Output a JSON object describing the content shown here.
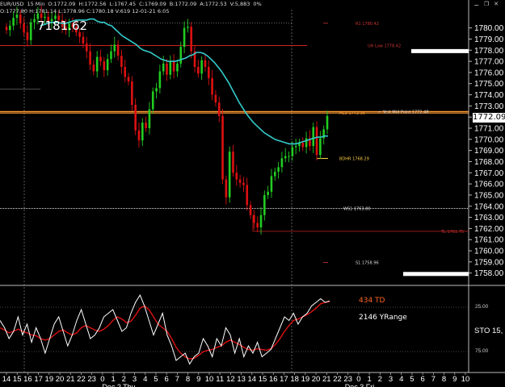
{
  "header": {
    "pair": "EUR/USD",
    "timeframe": "15 Min",
    "open": "O:1772.09",
    "high": "H:1772.56",
    "low": "L:1767.45",
    "close": "C:1769.09",
    "bid": "B:1772.09",
    "ask": "A:1772.53",
    "volume": "V:5,883",
    "extra": "0%"
  },
  "header2": {
    "open": "O:1777.80",
    "high": "H:1781.14",
    "low": "L:1778.96",
    "close": "C:1780.18",
    "vol": "V:619",
    "time": "12-01-21",
    "tick": "6:05"
  },
  "big_label": "7181.62",
  "current_price": "1772.09",
  "level_labels": {
    "r1": "R1 1780.42",
    "uh_low": "UH Low 1778.42",
    "hl3": "HL3 1772.36",
    "yest_mid": "Yest Mid Point 1772.48",
    "bdhr": "BDHR 1768.29",
    "ws1": "WS1 1763.80",
    "tl": "TL 1761.75",
    "s1": "S1 1758.96"
  },
  "indicator": {
    "td_label": "434 TD",
    "yrange_label": "2146 YRange",
    "sto_label": "STO 15,",
    "level_upper": "25.00",
    "level_lower": "75.00"
  },
  "icons": [
    "minimize-icon",
    "restore-icon",
    "close-icon"
  ],
  "colors": {
    "background": "#000000",
    "up_candle": "#22cc22",
    "down_candle": "#dd1111",
    "ma_line": "#33cccc",
    "level_red": "#cc2222",
    "level_orange": "#ff9933",
    "level_white": "#dddddd",
    "stoch_k": "#ffffff",
    "stoch_d": "#dd1111",
    "td_text": "#ff6622"
  },
  "chart_data": {
    "type": "line",
    "title": "",
    "series_kind": "candlestick",
    "y_range": [
      1757,
      1781.6
    ],
    "y_ticks": [
      1780,
      1779,
      1778,
      1777,
      1776,
      1775,
      1774,
      1773,
      1772,
      1771,
      1770,
      1769,
      1768,
      1767,
      1766,
      1765,
      1764,
      1763,
      1762,
      1761,
      1760,
      1759,
      1758
    ],
    "x_ticks": [
      "14",
      "15",
      "16",
      "17",
      "19",
      "20",
      "21",
      "22",
      "23",
      "0",
      "1",
      "2",
      "3",
      "4",
      "5",
      "6",
      "7",
      "8",
      "9",
      "10",
      "11",
      "12",
      "13",
      "14",
      "15",
      "16",
      "17",
      "18",
      "19",
      "20",
      "21",
      "22",
      "23",
      "0",
      "1",
      "2",
      "3",
      "4",
      "5",
      "6",
      "7",
      "8",
      "9",
      "10"
    ],
    "x_sublabels": [
      "Dec 2 Thu",
      "Dec 3 Fri"
    ],
    "closes": [
      1779.8,
      1780.2,
      1780.9,
      1781.2,
      1780.4,
      1779.6,
      1778.9,
      1780.5,
      1780.8,
      1781.3,
      1780.9,
      1781.0,
      1780.6,
      1780.8,
      1781.1,
      1780.7,
      1780.1,
      1779.8,
      1780.4,
      1780.1,
      1779.6,
      1779.2,
      1778.6,
      1777.9,
      1776.7,
      1776.1,
      1777.4,
      1777.0,
      1776.2,
      1777.2,
      1777.9,
      1778.5,
      1777.5,
      1776.5,
      1775.6,
      1775.2,
      1773.1,
      1770.8,
      1769.9,
      1771.5,
      1771.0,
      1772.7,
      1774.3,
      1774.6,
      1776.1,
      1776.8,
      1775.8,
      1777.0,
      1776.1,
      1776.8,
      1778.3,
      1780.0,
      1780.1,
      1777.9,
      1776.5,
      1775.9,
      1777.1,
      1776.5,
      1775.5,
      1774.0,
      1773.3,
      1772.1,
      1766.4,
      1764.8,
      1768.9,
      1767.0,
      1766.4,
      1766.1,
      1765.9,
      1764.1,
      1763.2,
      1762.5,
      1762.1,
      1763.2,
      1765.0,
      1765.3,
      1766.7,
      1767.1,
      1767.5,
      1768.3,
      1768.5,
      1768.5,
      1769.3,
      1769.4,
      1769.7,
      1769.3,
      1770.1,
      1769.4,
      1771.1,
      1768.6,
      1770.1,
      1770.9,
      1772.1
    ],
    "ma": [
      1780.2,
      1780.3,
      1780.4,
      1780.5,
      1780.5,
      1780.5,
      1780.4,
      1780.4,
      1780.5,
      1780.6,
      1780.7,
      1780.7,
      1780.7,
      1780.7,
      1780.8,
      1780.8,
      1780.6,
      1780.5,
      1780.5,
      1780.3,
      1780.2,
      1779.9,
      1779.6,
      1779.3,
      1779.1,
      1778.9,
      1778.7,
      1778.5,
      1778.2,
      1778.0,
      1777.9,
      1777.8,
      1777.6,
      1777.4,
      1777.2,
      1777.1,
      1777.0,
      1777.0,
      1777.0,
      1777.1,
      1777.2,
      1777.3,
      1777.5,
      1777.6,
      1777.8,
      1777.8,
      1777.7,
      1777.5,
      1777.2,
      1776.9,
      1776.5,
      1776.1,
      1775.6,
      1775.1,
      1774.5,
      1773.9,
      1773.3,
      1772.8,
      1772.3,
      1771.9,
      1771.5,
      1771.2,
      1770.9,
      1770.6,
      1770.4,
      1770.2,
      1770.0,
      1769.9,
      1769.8,
      1769.7,
      1769.6,
      1769.6,
      1769.6,
      1769.7,
      1769.8,
      1769.9,
      1770.0,
      1770.1,
      1770.2,
      1770.2,
      1770.3,
      1770.3
    ],
    "stoch_k": [
      35,
      45,
      60,
      50,
      30,
      55,
      40,
      65,
      45,
      60,
      80,
      60,
      40,
      30,
      50,
      70,
      55,
      35,
      20,
      40,
      60,
      55,
      45,
      30,
      25,
      20,
      35,
      50,
      45,
      25,
      10,
      0,
      15,
      35,
      55,
      40,
      25,
      55,
      70,
      90,
      85,
      80,
      95,
      85,
      80,
      60,
      70,
      85,
      60,
      70,
      45,
      55,
      80,
      60,
      85,
      70,
      80,
      65,
      85,
      80,
      75,
      60,
      45,
      30,
      35,
      25,
      40,
      30,
      25,
      15,
      10,
      5,
      10,
      8
    ],
    "stoch_d": [
      45,
      48,
      52,
      50,
      47,
      50,
      52,
      55,
      56,
      60,
      62,
      60,
      55,
      50,
      48,
      52,
      55,
      52,
      45,
      42,
      45,
      48,
      50,
      47,
      42,
      35,
      30,
      33,
      38,
      36,
      28,
      18,
      15,
      20,
      30,
      40,
      45,
      50,
      60,
      72,
      80,
      85,
      88,
      87,
      83,
      78,
      76,
      75,
      72,
      70,
      65,
      62,
      65,
      68,
      72,
      75,
      76,
      74,
      75,
      76,
      74,
      68,
      60,
      50,
      42,
      35,
      33,
      30,
      27,
      23,
      18,
      12,
      10,
      9
    ],
    "ylabel": "",
    "xlabel": ""
  }
}
